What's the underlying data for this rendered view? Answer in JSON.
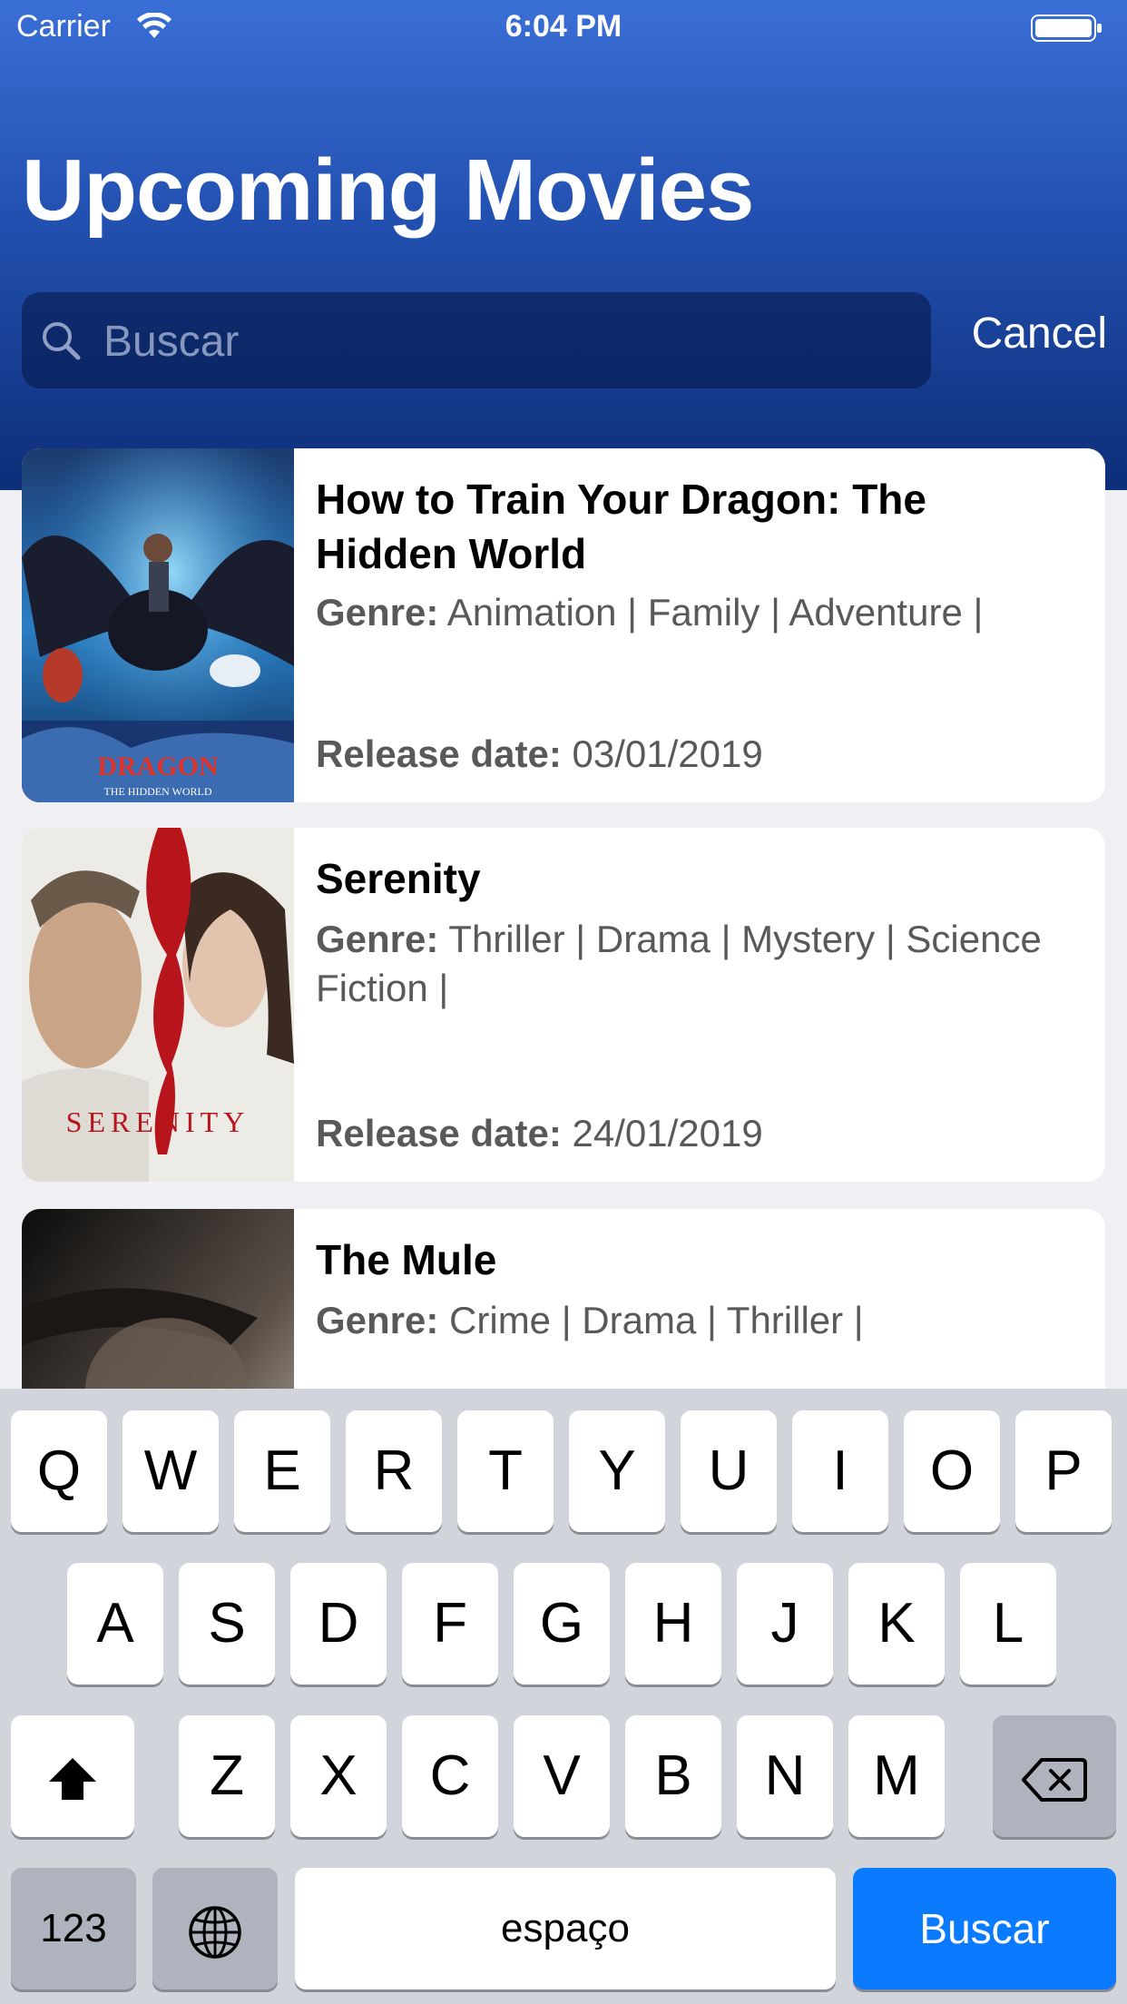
{
  "status_bar": {
    "carrier": "Carrier",
    "time": "6:04 PM"
  },
  "header": {
    "title": "Upcoming Movies"
  },
  "search": {
    "placeholder": "Buscar",
    "value": "",
    "cancel_label": "Cancel"
  },
  "movies": [
    {
      "title": "How to Train Your Dragon: The Hidden World",
      "genre_label": "Genre:",
      "genres": "Animation | Family | Adventure |",
      "release_label": "Release date:",
      "release_date": "03/01/2019",
      "poster_text_top": "DRAGON",
      "poster_text_bottom": "THE HIDDEN WORLD"
    },
    {
      "title": "Serenity",
      "genre_label": "Genre:",
      "genres": "Thriller | Drama | Mystery | Science Fiction |",
      "release_label": "Release date:",
      "release_date": "24/01/2019",
      "poster_text": "SERENITY"
    },
    {
      "title": "The Mule",
      "genre_label": "Genre:",
      "genres": "Crime | Drama | Thriller |"
    }
  ],
  "keyboard": {
    "row1": [
      "Q",
      "W",
      "E",
      "R",
      "T",
      "Y",
      "U",
      "I",
      "O",
      "P"
    ],
    "row2": [
      "A",
      "S",
      "D",
      "F",
      "G",
      "H",
      "J",
      "K",
      "L"
    ],
    "row3": [
      "Z",
      "X",
      "C",
      "V",
      "B",
      "N",
      "M"
    ],
    "numbers_label": "123",
    "space_label": "espaço",
    "return_label": "Buscar",
    "icons": [
      "shift-icon",
      "delete-icon",
      "globe-icon"
    ]
  },
  "colors": {
    "header_top": "#3a6fd6",
    "header_bottom": "#0d2e78",
    "search_button": "#0a7aff",
    "background": "#efeff4"
  }
}
